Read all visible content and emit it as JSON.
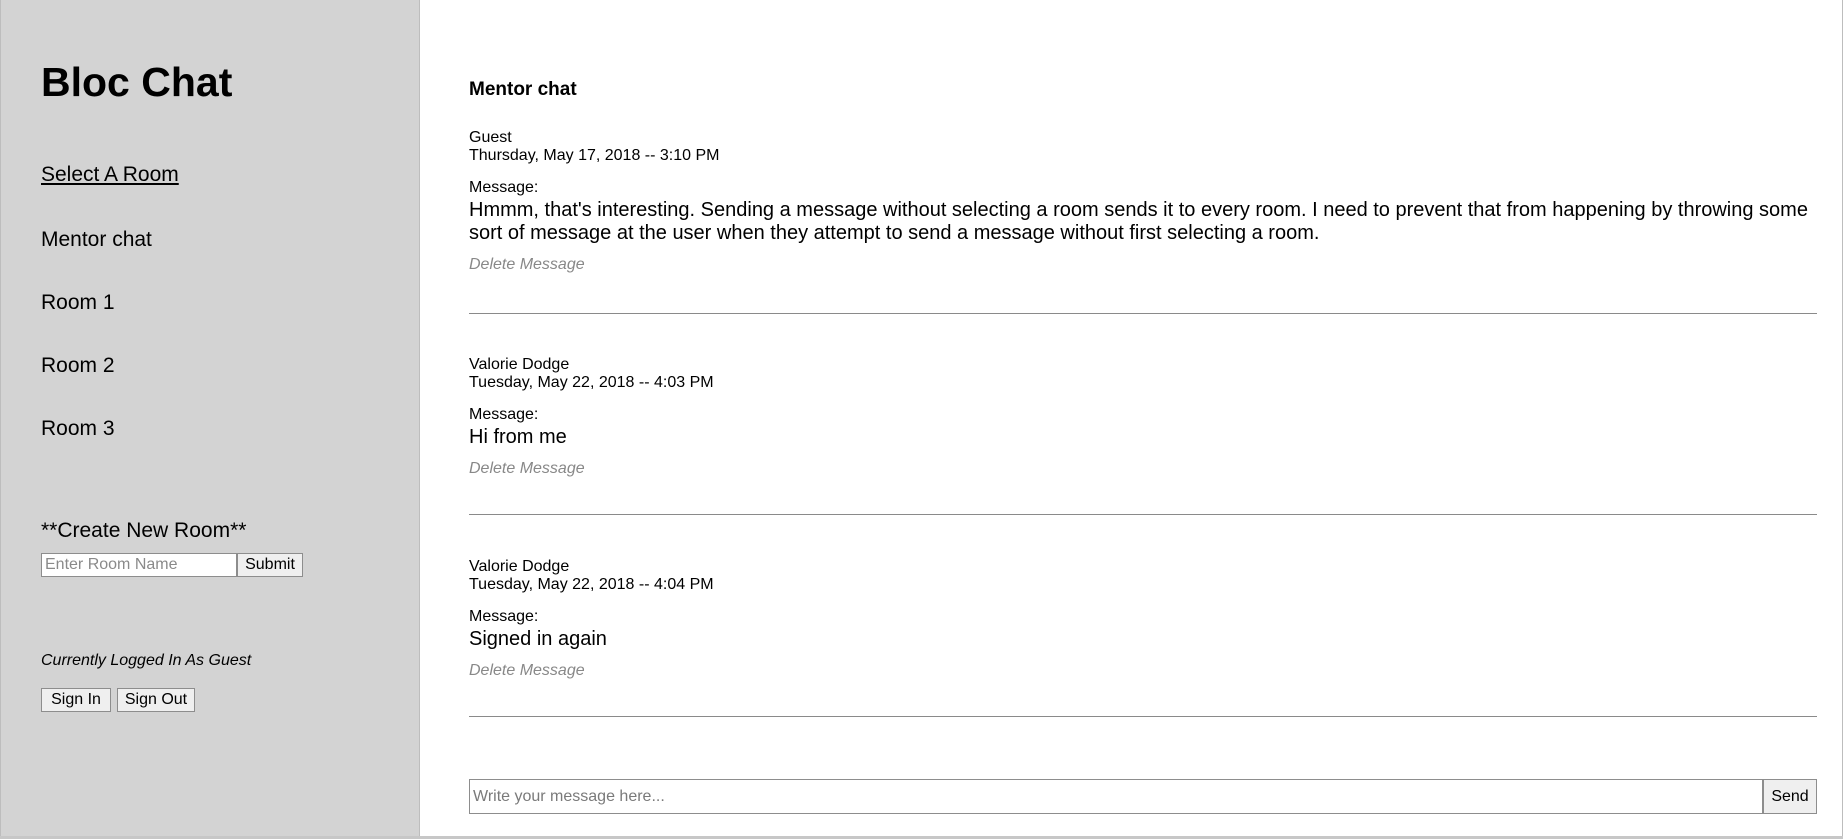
{
  "sidebar": {
    "app_title": "Bloc Chat",
    "select_room_label": "Select A Room",
    "rooms": [
      "Mentor chat",
      "Room 1",
      "Room 2",
      "Room 3"
    ],
    "create_room_label": "**Create New Room**",
    "room_name_placeholder": "Enter Room Name",
    "submit_label": "Submit",
    "status_text": "Currently Logged In As Guest",
    "sign_in_label": "Sign In",
    "sign_out_label": "Sign Out"
  },
  "main": {
    "room_title": "Mentor chat",
    "messages": [
      {
        "user": "Guest",
        "time": "Thursday, May 17, 2018 -- 3:10 PM",
        "label": "Message:",
        "content": "Hmmm, that's interesting. Sending a message without selecting a room sends it to every room. I need to prevent that from happening by throwing some sort of message at the user when they attempt to send a message without first selecting a room.",
        "delete_label": "Delete Message"
      },
      {
        "user": "Valorie Dodge",
        "time": "Tuesday, May 22, 2018 -- 4:03 PM",
        "label": "Message:",
        "content": "Hi from me",
        "delete_label": "Delete Message"
      },
      {
        "user": "Valorie Dodge",
        "time": "Tuesday, May 22, 2018 -- 4:04 PM",
        "label": "Message:",
        "content": "Signed in again",
        "delete_label": "Delete Message"
      }
    ],
    "composer": {
      "placeholder": "Write your message here...",
      "send_label": "Send"
    }
  }
}
